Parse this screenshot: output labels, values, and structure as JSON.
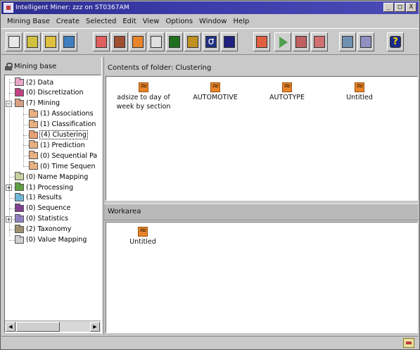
{
  "window": {
    "title": "Intelligent Miner: zzz on ST0367AM",
    "controls": [
      "_",
      "□",
      "X"
    ]
  },
  "menubar": [
    "Mining Base",
    "Create",
    "Selected",
    "Edit",
    "View",
    "Options",
    "Window",
    "Help"
  ],
  "toolbar": {
    "buttons": [
      {
        "name": "new-icon",
        "color": "#e8e8e8"
      },
      {
        "name": "edit-icon",
        "color": "#d0c040"
      },
      {
        "name": "open-folder-icon",
        "color": "#e0c040"
      },
      {
        "name": "import-icon",
        "color": "#4080c0"
      },
      {
        "name": "table-icon",
        "color": "#e06060"
      },
      {
        "name": "film-icon",
        "color": "#a05030"
      },
      {
        "name": "mining-icon",
        "color": "#e8842a"
      },
      {
        "name": "chart-icon",
        "color": "#e0e0e0"
      },
      {
        "name": "process-icon",
        "color": "#207020"
      },
      {
        "name": "arrow-right-icon",
        "color": "#c09020"
      },
      {
        "name": "sigma-icon",
        "color": "#203080"
      },
      {
        "name": "bar-icon",
        "color": "#202080"
      },
      {
        "name": "report-icon",
        "color": "#e06040"
      },
      {
        "name": "run-icon",
        "color": "#50a050"
      },
      {
        "name": "stop-run-icon",
        "color": "#c06060"
      },
      {
        "name": "delete-icon",
        "color": "#d07070"
      },
      {
        "name": "results-icon",
        "color": "#7090b0"
      },
      {
        "name": "visualize-icon",
        "color": "#9090c0"
      },
      {
        "name": "help-icon",
        "color": "#1a2a8a"
      }
    ]
  },
  "sidebar": {
    "title": "Mining base",
    "items": [
      {
        "label": "(2) Data",
        "color": "#e8a8c8",
        "indent": 0,
        "expander": ""
      },
      {
        "label": "(0) Discretization",
        "color": "#c04080",
        "indent": 0,
        "expander": ""
      },
      {
        "label": "(7) Mining",
        "color": "#d8a080",
        "indent": 0,
        "expander": "−"
      },
      {
        "label": "(1) Associations",
        "color": "#e8b080",
        "indent": 1,
        "expander": ""
      },
      {
        "label": "(1) Classification",
        "color": "#e8b080",
        "indent": 1,
        "expander": ""
      },
      {
        "label": "(4) Clustering",
        "color": "#e8a070",
        "indent": 1,
        "expander": "",
        "selected": true
      },
      {
        "label": "(1) Prediction",
        "color": "#e8b080",
        "indent": 1,
        "expander": ""
      },
      {
        "label": "(0) Sequential Pa",
        "color": "#e8b080",
        "indent": 1,
        "expander": ""
      },
      {
        "label": "(0) Time Sequen",
        "color": "#e8b080",
        "indent": 1,
        "expander": ""
      },
      {
        "label": "(0) Name Mapping",
        "color": "#c8d0a0",
        "indent": 0,
        "expander": ""
      },
      {
        "label": "(1) Processing",
        "color": "#60a040",
        "indent": 0,
        "expander": "+"
      },
      {
        "label": "(1) Results",
        "color": "#70b8d8",
        "indent": 0,
        "expander": ""
      },
      {
        "label": "(0) Sequence",
        "color": "#804090",
        "indent": 0,
        "expander": ""
      },
      {
        "label": "(0) Statistics",
        "color": "#9080c0",
        "indent": 0,
        "expander": "+"
      },
      {
        "label": "(2) Taxonomy",
        "color": "#a09070",
        "indent": 0,
        "expander": ""
      },
      {
        "label": "(0) Value Mapping",
        "color": "#d0d0d0",
        "indent": 0,
        "expander": ""
      }
    ]
  },
  "contents": {
    "header": "Contents of folder: Clustering",
    "items": [
      {
        "label": "adsize to day of week by section"
      },
      {
        "label": "AUTOMOTIVE"
      },
      {
        "label": "AUTOTYPE"
      },
      {
        "label": "Untitled"
      }
    ]
  },
  "workarea": {
    "header": "Workarea",
    "items": [
      {
        "label": "Untitled"
      }
    ]
  }
}
